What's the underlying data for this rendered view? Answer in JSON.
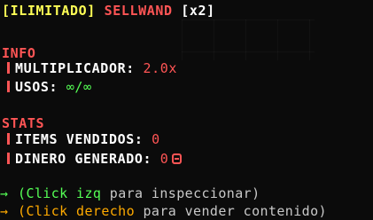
{
  "title": {
    "tag": "[ILIMITADO]",
    "name": "SELLWAND",
    "multiplier_tag": "[x2]"
  },
  "info": {
    "header": "INFO",
    "multiplicador_label": "MULTIPLICADOR:",
    "multiplicador_value": "2.0x",
    "usos_label": "USOS:",
    "usos_value": "∞/∞"
  },
  "stats": {
    "header": "STATS",
    "items_label": "ITEMS VENDIDOS:",
    "items_value": "0",
    "dinero_label": "DINERO GENERADO:",
    "dinero_value": "0"
  },
  "actions": {
    "left_arrow": "→",
    "left_open": "(",
    "left_key": "Click izq",
    "left_text": " para inspeccionar)",
    "right_arrow": "→",
    "right_open": "(",
    "right_key": "Click derecho",
    "right_text": " para vender contenido)"
  },
  "colors": {
    "red": "#ff5555",
    "yellow": "#ffff55",
    "gold": "#ffaa00",
    "green": "#55ff55",
    "white": "#ffffff",
    "gray": "#aaaaaa"
  },
  "icons": {
    "coin": "coin-icon",
    "arrow": "arrow-right-icon",
    "bar": "red-bar-marker"
  }
}
